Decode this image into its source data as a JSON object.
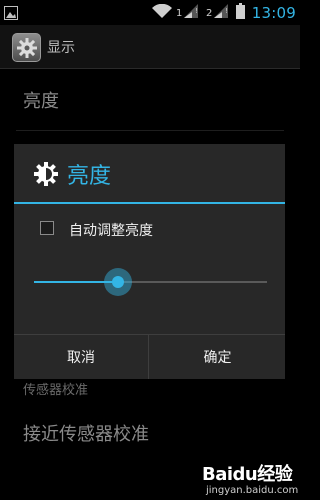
{
  "status_bar": {
    "time": "13:09",
    "icons": [
      "image-notification-icon",
      "wifi-icon",
      "signal-1-icon",
      "signal-2-icon",
      "battery-icon"
    ]
  },
  "action_bar": {
    "title": "显示",
    "icon": "settings-gear-icon"
  },
  "list": {
    "brightness_label": "亮度",
    "sensor_calibration_label": "传感器校准",
    "proximity_calibration_label": "接近传感器校准"
  },
  "dialog": {
    "title": "亮度",
    "icon": "brightness-icon",
    "auto_adjust_label": "自动调整亮度",
    "auto_adjust_checked": false,
    "brightness_level": 0.36,
    "cancel_label": "取消",
    "ok_label": "确定"
  },
  "watermark": {
    "logo": "Baidu经验",
    "url": "jingyan.baidu.com"
  },
  "colors": {
    "accent": "#33b5e5",
    "dialog_bg": "#282828",
    "background": "#000000"
  }
}
